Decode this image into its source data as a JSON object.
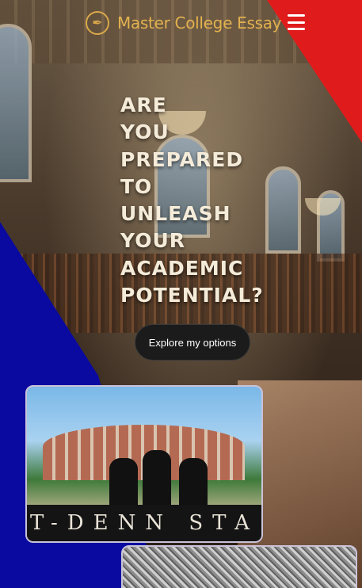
{
  "header": {
    "brand": "Master College Essay",
    "logo_icon": "quill-icon",
    "menu_icon": "hamburger-menu-icon"
  },
  "hero": {
    "headline_lines": [
      "ARE",
      "YOU",
      "PREPARED",
      "TO",
      "UNLEASH",
      "YOUR",
      "ACADEMIC",
      "POTENTIAL?"
    ],
    "cta_label": "Explore my options"
  },
  "gallery": {
    "photo_sign_text": "T-DENN STA"
  },
  "colors": {
    "accent_gold": "#e2b24e",
    "corner_red": "#e01b1b",
    "corner_blue": "#0a0aa0"
  }
}
